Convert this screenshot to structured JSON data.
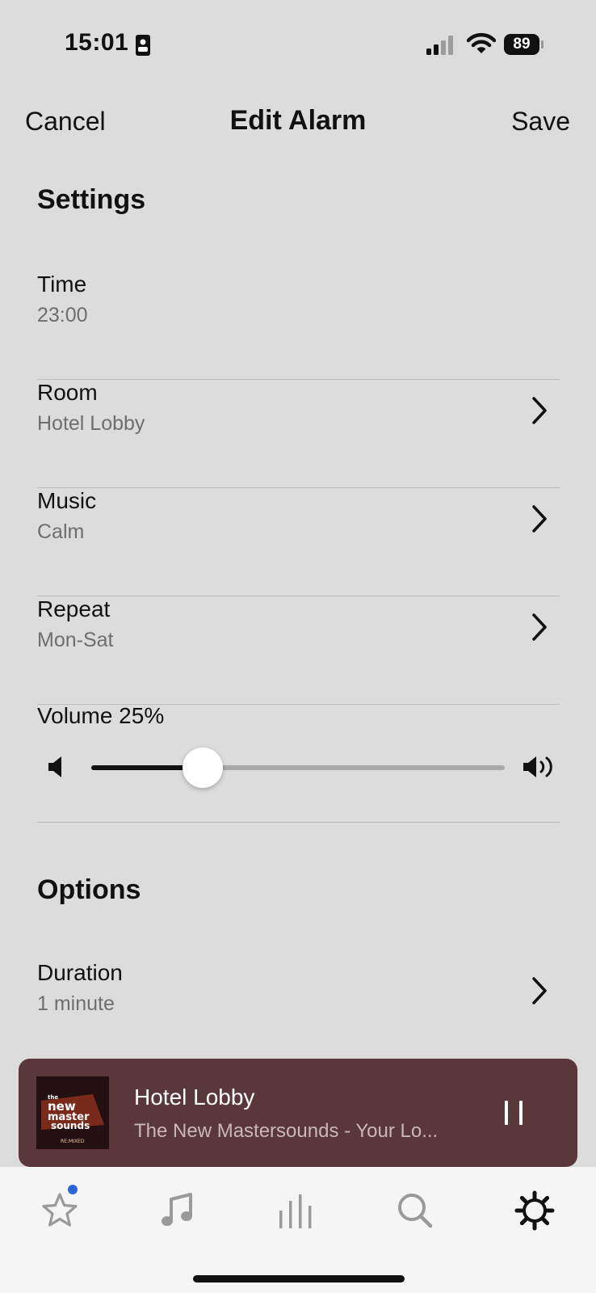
{
  "status_bar": {
    "time": "15:01",
    "battery": "89",
    "icons": [
      "id-card-icon",
      "cellular-signal-icon",
      "wifi-icon",
      "battery-icon"
    ]
  },
  "nav": {
    "cancel": "Cancel",
    "title": "Edit Alarm",
    "save": "Save"
  },
  "settings": {
    "heading": "Settings",
    "time": {
      "label": "Time",
      "value": "23:00"
    },
    "room": {
      "label": "Room",
      "value": "Hotel Lobby"
    },
    "music": {
      "label": "Music",
      "value": "Calm"
    },
    "repeat": {
      "label": "Repeat",
      "value": "Mon-Sat"
    },
    "volume": {
      "label": "Volume 25%",
      "level": 0.27
    }
  },
  "options": {
    "heading": "Options",
    "duration": {
      "label": "Duration",
      "value": "1 minute"
    }
  },
  "now_playing": {
    "title": "Hotel Lobby",
    "subtitle": "The New Mastersounds - Your Lo...",
    "album_art": {
      "line1": "the",
      "line2": "new",
      "line3": "master",
      "line4": "sounds",
      "line5": "RE:MIXED"
    }
  },
  "tabs": [
    {
      "name": "favorites",
      "icon": "star-icon",
      "badge": true
    },
    {
      "name": "browse",
      "icon": "music-note-icon"
    },
    {
      "name": "rooms",
      "icon": "equalizer-bars-icon"
    },
    {
      "name": "search",
      "icon": "search-icon"
    },
    {
      "name": "settings",
      "icon": "gear-icon",
      "active": true
    }
  ],
  "colors": {
    "background": "#dcdcdc",
    "now_playing_bg": "#59373b",
    "badge": "#2d64d6",
    "tab_inactive": "#9a9a9a",
    "tab_active": "#111111"
  }
}
